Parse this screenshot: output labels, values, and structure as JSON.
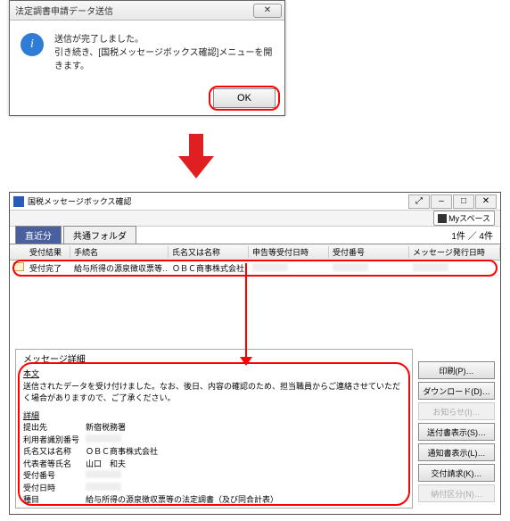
{
  "dialog": {
    "title": "法定調書申請データ送信",
    "line1": "送信が完了しました。",
    "line2": "引き続き、[国税メッセージボックス確認]メニューを開きます。",
    "ok": "OK"
  },
  "mainWindow": {
    "title": "国税メッセージボックス確認",
    "mySpace": "Myスペース",
    "tabs": {
      "active": "直近分",
      "other": "共通フォルダ"
    },
    "count": "1件 ／ 4件",
    "columns": {
      "status": "受付結果",
      "procedure": "手続名",
      "name": "氏名又は名称",
      "receiptDate": "申告等受付日時",
      "receiptNo": "受付番号",
      "messageDate": "メッセージ発行日時"
    },
    "row": {
      "status": "受付完了",
      "procedure": "給与所得の源泉徴収票等…",
      "name": "ＯＢＣ商事株式会社"
    },
    "detail": {
      "sectionTitle": "メッセージ詳細",
      "bodyLabel": "本文",
      "bodyText": "送信されたデータを受け付けました。なお、後日、内容の確認のため、担当職員からご連絡させていただく場合がありますので、ご了承ください。",
      "detailsLabel": "詳細",
      "fields": {
        "office": {
          "label": "提出先",
          "value": "新宿税務署"
        },
        "userId": {
          "label": "利用者識別番号",
          "value": ""
        },
        "name": {
          "label": "氏名又は名称",
          "value": "ＯＢＣ商事株式会社"
        },
        "rep": {
          "label": "代表者等氏名",
          "value": "山口　和夫"
        },
        "receiptNo": {
          "label": "受付番号",
          "value": ""
        },
        "receiptDate": {
          "label": "受付日時",
          "value": ""
        },
        "kind": {
          "label": "種目",
          "value": "給与所得の源泉徴収票等の法定調書（及び同合計表）"
        }
      }
    },
    "buttons": {
      "print": "印刷(P)…",
      "download": "ダウンロード(D)…",
      "notice": "お知らせ(I)…",
      "attach": "送付書表示(S)…",
      "notify": "通知書表示(L)…",
      "receipt": "交付請求(K)…",
      "delivery": "納付区分(N)…"
    }
  }
}
